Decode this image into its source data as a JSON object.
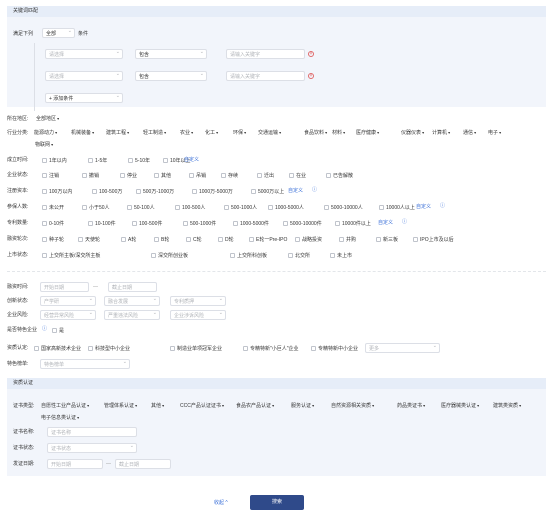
{
  "kw": {
    "title": "关键词匹配",
    "match_label": "满足下列",
    "match_value": "全部",
    "cond_label": "条件",
    "rows": [
      {
        "field": "请选择",
        "op": "包含",
        "kw": "请输入关键字"
      },
      {
        "field": "请选择",
        "op": "包含",
        "kw": "请输入关键字"
      }
    ],
    "add": "+ 添加条件"
  },
  "region": {
    "label": "所在地区:",
    "value": "全部地区"
  },
  "industry": {
    "label": "行业分类:",
    "items": [
      "能源动力",
      "机械装备",
      "建筑工程",
      "轻工制造",
      "农业",
      "化工",
      "环保",
      "交通运输",
      "食品饮料",
      "材料",
      "医疗健康",
      "仪器仪表",
      "计算机",
      "通信",
      "电子",
      "物联网"
    ]
  },
  "filters": [
    {
      "label": "成立时间:",
      "opts": [
        "1年以内",
        "1-5年",
        "5-10年",
        "10年以上"
      ],
      "custom": "自定义"
    },
    {
      "label": "企业状态:",
      "opts": [
        "注销",
        "撤销",
        "停业",
        "其他",
        "吊销",
        "存续",
        "迁出",
        "在业",
        "已告解散"
      ]
    },
    {
      "label": "注册资本:",
      "opts": [
        "100万以内",
        "100-500万",
        "500万-1000万",
        "1000万-5000万",
        "5000万以上"
      ],
      "custom": "自定义"
    },
    {
      "label": "参保人数:",
      "opts": [
        "未公开",
        "小于50人",
        "50-100人",
        "100-500人",
        "500-1000人",
        "1000-5000人",
        "5000-10000人",
        "10000人以上"
      ],
      "custom": "自定义"
    },
    {
      "label": "专利数量:",
      "opts": [
        "0-10件",
        "10-100件",
        "100-500件",
        "500-1000件",
        "1000-5000件",
        "5000-10000件",
        "10000件以上"
      ],
      "custom": "自定义"
    },
    {
      "label": "融资轮次:",
      "opts": [
        "种子轮",
        "天使轮",
        "A轮",
        "B轮",
        "C轮",
        "D轮",
        "E轮一Pre-IPO",
        "战略投资",
        "并购",
        "新三板",
        "IPO上市及以后"
      ]
    },
    {
      "label": "上市状态:",
      "opts": [
        "上交所主板/深交所主板",
        "深交所创业板",
        "上交所科创板",
        "北交所",
        "未上市"
      ]
    }
  ],
  "finance": {
    "label": "融资时间:",
    "start": "开始日期",
    "end": "截止日期"
  },
  "innovation": {
    "label": "创新状态:",
    "sels": [
      "产学研",
      "融合发展",
      "专利质押"
    ]
  },
  "risk": {
    "label": "企业风险:",
    "sels": [
      "经营异常风险",
      "严重违法风险",
      "企业涉诉风险"
    ]
  },
  "special": {
    "label": "是否特色企业",
    "opt": "是"
  },
  "qualification": {
    "label": "资质认定:",
    "opts": [
      "国家高新技术企业",
      "科技型中小企业",
      "制造业单项冠军企业",
      "专精特新\"小巨人\"企业",
      "专精特新中小企业"
    ],
    "more": "更多"
  },
  "ranking": {
    "label": "特色榜单:",
    "placeholder": "特色榜单"
  },
  "cert": {
    "title": "资质认证",
    "type_label": "证书类型:",
    "types": [
      "自愿性工业产品认证",
      "管理体系认证",
      "其他",
      "CCC产品认证证书",
      "食品农产品认证",
      "服务认证",
      "自然资源相关资质",
      "药品类证书",
      "医疗器械类认证",
      "建筑类资质",
      "电子信息类认证"
    ],
    "name_label": "证书名称:",
    "name_ph": "证书名称",
    "status_label": "证书状态:",
    "status_ph": "证书状态",
    "date_label": "发证日期:",
    "start": "开始日期",
    "end": "截止日期"
  },
  "footer": {
    "collapse": "收起 ^",
    "search": "搜索"
  },
  "colors": {
    "accent": "#3a6fd8",
    "button": "#2f4a8a",
    "panel": "#f2f5fb"
  }
}
